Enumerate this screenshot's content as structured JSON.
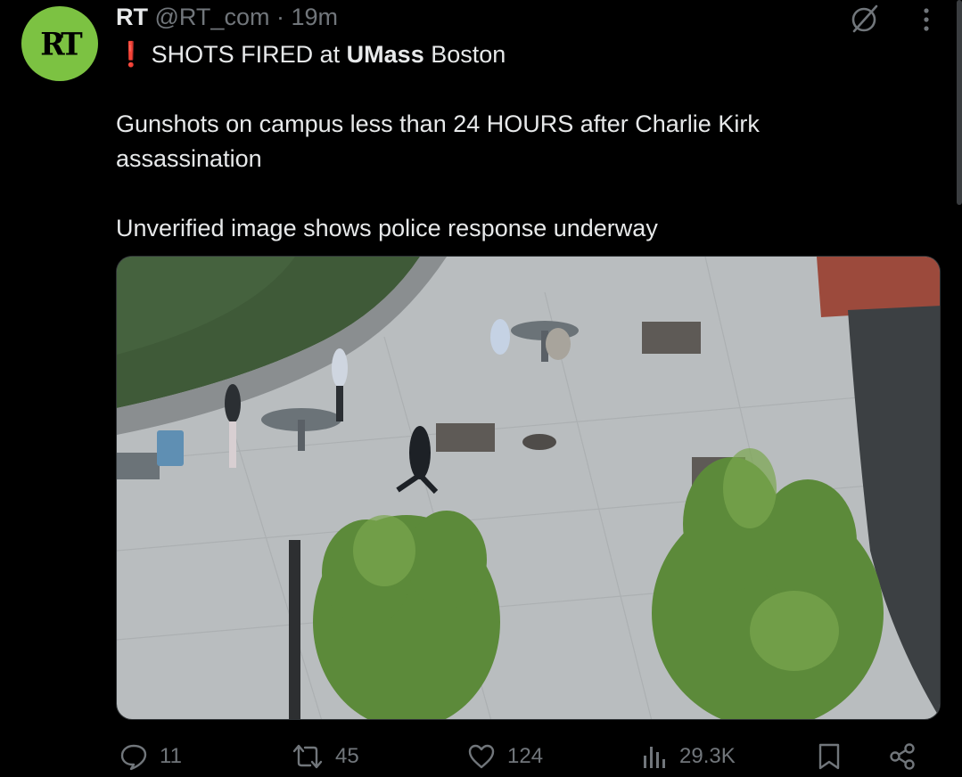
{
  "author": {
    "name": "RT",
    "handle": "@RT_com",
    "separator": "·",
    "time": "19m",
    "avatar_text": "RT",
    "avatar_color": "#7cc242"
  },
  "tweet": {
    "line1_alert": "❗",
    "line1_a": "SHOTS FIRED at ",
    "line1_bold": "UMass",
    "line1_b": " Boston",
    "line2": "Gunshots on campus less than 24 HOURS after Charlie Kirk",
    "line3": "assassination",
    "line4": "Unverified image shows police response underway"
  },
  "media": {
    "icon": "photo"
  },
  "icons": {
    "grok": "grok-icon",
    "more": "more-icon",
    "reply": "reply-icon",
    "retweet": "retweet-icon",
    "like": "heart-icon",
    "views": "views-icon",
    "bookmark": "bookmark-icon",
    "share": "share-icon"
  },
  "actions": {
    "reply_count": "11",
    "retweet_count": "45",
    "like_count": "124",
    "views_count": "29.3K"
  },
  "colors": {
    "background": "#000000",
    "text": "#e7e9ea",
    "muted": "#71767b",
    "alert": "#e0245e"
  }
}
